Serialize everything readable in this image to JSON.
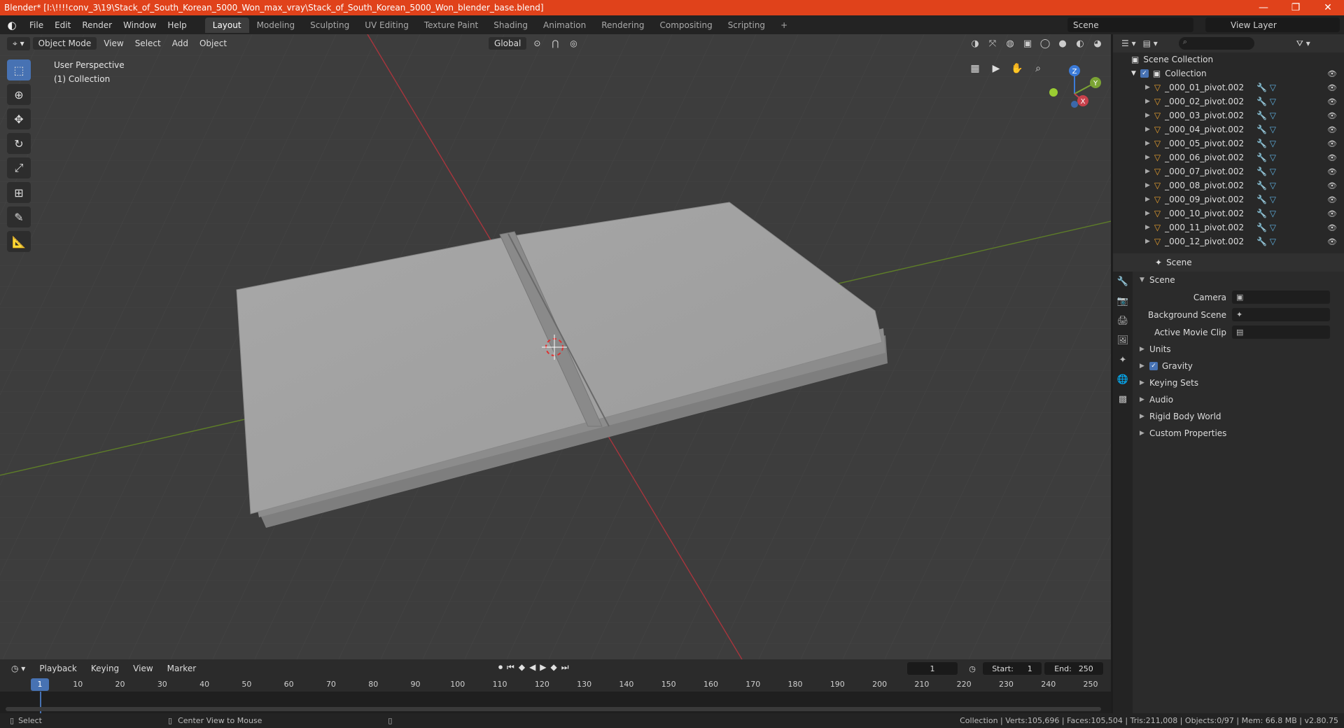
{
  "window": {
    "title": "Blender* [I:\\!!!!conv_3\\19\\Stack_of_South_Korean_5000_Won_max_vray\\Stack_of_South_Korean_5000_Won_blender_base.blend]",
    "minimize": "—",
    "maximize": "❐",
    "close": "✕"
  },
  "menu": {
    "logo": "◐",
    "items": [
      "File",
      "Edit",
      "Render",
      "Window",
      "Help"
    ],
    "workspaces": [
      "Layout",
      "Modeling",
      "Sculpting",
      "UV Editing",
      "Texture Paint",
      "Shading",
      "Animation",
      "Rendering",
      "Compositing",
      "Scripting"
    ],
    "add_tab": "+",
    "scene": "Scene",
    "view_layer": "View Layer"
  },
  "viewport": {
    "mode": "Object Mode",
    "menus": [
      "View",
      "Select",
      "Add",
      "Object"
    ],
    "orientation": "Global",
    "perspective": "User Perspective",
    "collection": "(1) Collection",
    "gizmo": {
      "z": "Z",
      "y": "Y",
      "x": "X"
    }
  },
  "outliner": {
    "root": "Scene Collection",
    "collection": "Collection",
    "items": [
      "_000_01_pivot.002",
      "_000_02_pivot.002",
      "_000_03_pivot.002",
      "_000_04_pivot.002",
      "_000_05_pivot.002",
      "_000_06_pivot.002",
      "_000_07_pivot.002",
      "_000_08_pivot.002",
      "_000_09_pivot.002",
      "_000_10_pivot.002",
      "_000_11_pivot.002",
      "_000_12_pivot.002"
    ]
  },
  "properties": {
    "header": "Scene",
    "section": "Scene",
    "camera_label": "Camera",
    "background_scene_label": "Background Scene",
    "active_movie_clip_label": "Active Movie Clip",
    "subsections": [
      "Units",
      "Gravity",
      "Keying Sets",
      "Audio",
      "Rigid Body World",
      "Custom Properties"
    ]
  },
  "timeline": {
    "menus": [
      "Playback",
      "Keying",
      "View",
      "Marker"
    ],
    "current_frame": "1",
    "start_label": "Start:",
    "start": "1",
    "end_label": "End:",
    "end": "250",
    "ticks": [
      "1",
      "10",
      "20",
      "30",
      "40",
      "50",
      "60",
      "70",
      "80",
      "90",
      "100",
      "110",
      "120",
      "130",
      "140",
      "150",
      "160",
      "170",
      "180",
      "190",
      "200",
      "210",
      "220",
      "230",
      "240",
      "250"
    ]
  },
  "status": {
    "select": "Select",
    "center_view": "Center View to Mouse",
    "stats": "Collection | Verts:105,696 | Faces:105,504 | Tris:211,008 | Objects:0/97 | Mem: 66.8 MB | v2.80.75"
  },
  "colors": {
    "titlebar": "#e0421b",
    "accent": "#4772b3",
    "x_axis": "#c8414b",
    "y_axis": "#7ba334",
    "object_icon": "#e8a030"
  }
}
